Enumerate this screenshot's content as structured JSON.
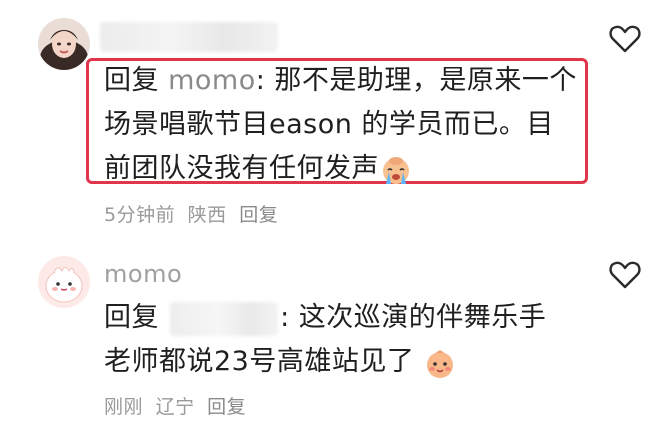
{
  "comments": [
    {
      "reply_prefix": "回复",
      "reply_to": "momo",
      "text_line1": ": 那不是助理，是原来一个",
      "text_line2": "场景唱歌节目eason 的学员而已。目",
      "text_line3": "前团队没我有任何发声",
      "emoji": "crying-face-emoji",
      "time": "5分钟前",
      "location": "陕西",
      "reply_action": "回复"
    },
    {
      "username": "momo",
      "reply_prefix": "回复",
      "text_line1": ": 这次巡演的伴舞乐手",
      "text_line2": "老师都说23号高雄站见了",
      "emoji": "smiling-face-emoji",
      "time": "刚刚",
      "location": "辽宁",
      "reply_action": "回复"
    }
  ],
  "colors": {
    "highlight": "#e0354b",
    "meta": "#9a9a9a"
  },
  "icons": [
    "heart-icon"
  ]
}
